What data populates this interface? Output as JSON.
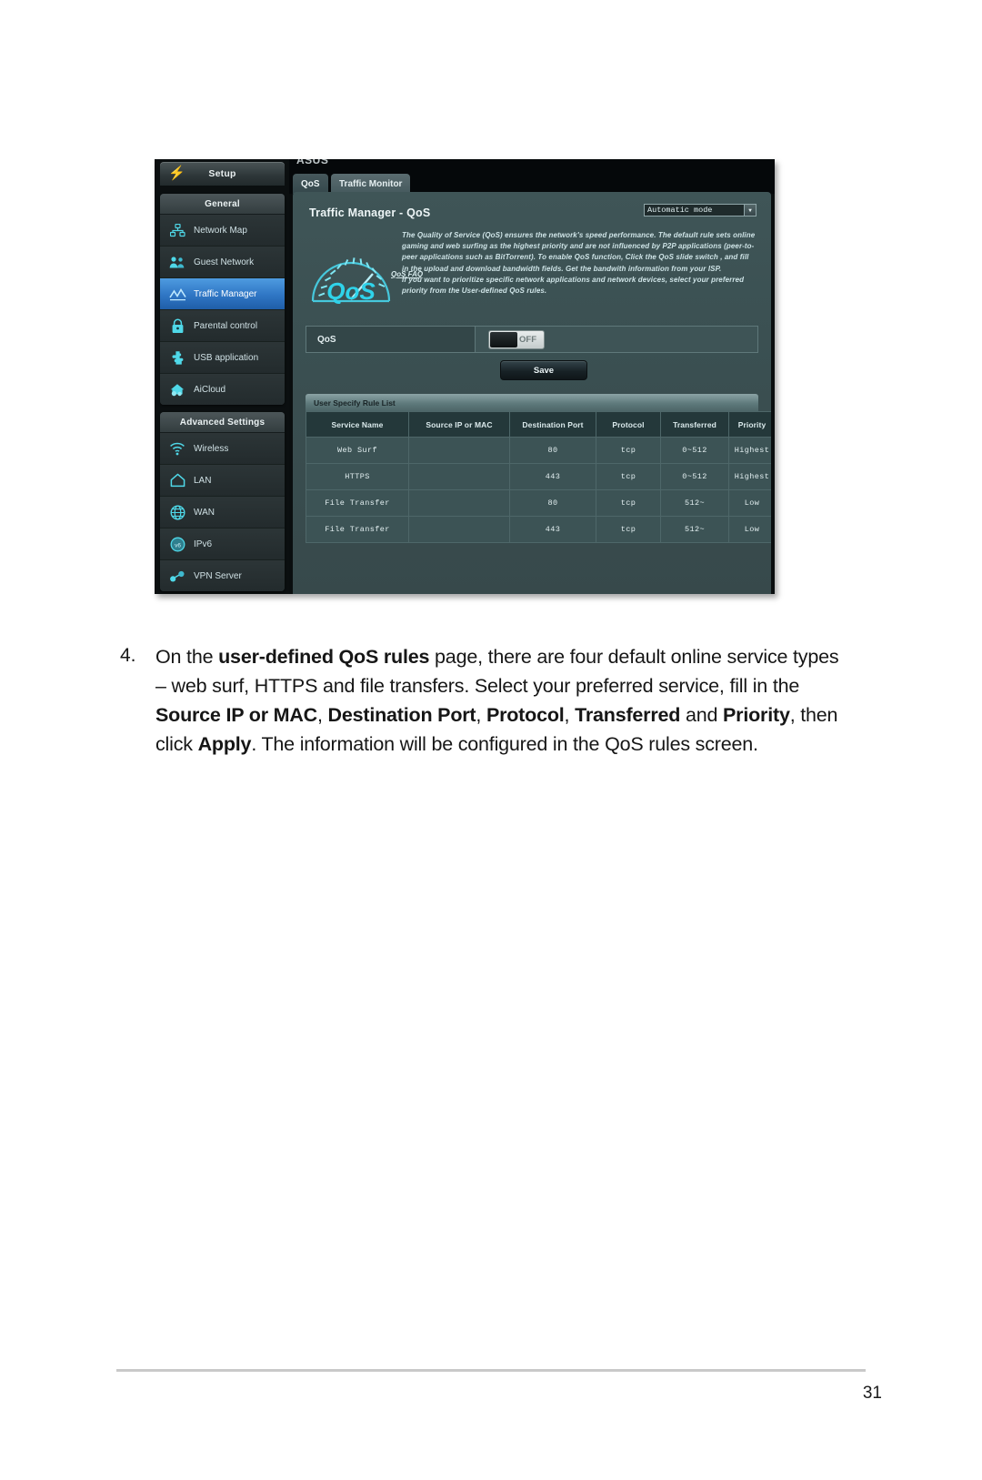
{
  "document": {
    "page_number": "31",
    "instruction": {
      "number": "4.",
      "segments": [
        {
          "text": "On the ",
          "bold": false
        },
        {
          "text": "user-defined QoS rules",
          "bold": true
        },
        {
          "text": " page, there are four default online service types – web surf, HTTPS and file transfers. Select your preferred service, fill in the ",
          "bold": false
        },
        {
          "text": "Source IP or MAC",
          "bold": true
        },
        {
          "text": ", ",
          "bold": false
        },
        {
          "text": "Destination Port",
          "bold": true
        },
        {
          "text": ", ",
          "bold": false
        },
        {
          "text": "Protocol",
          "bold": true
        },
        {
          "text": ", ",
          "bold": false
        },
        {
          "text": "Transferred",
          "bold": true
        },
        {
          "text": " and ",
          "bold": false
        },
        {
          "text": "Priority",
          "bold": true
        },
        {
          "text": ", then click ",
          "bold": false
        },
        {
          "text": "Apply",
          "bold": true
        },
        {
          "text": ". The information will be configured in the QoS rules screen.",
          "bold": false
        }
      ]
    }
  },
  "screenshot": {
    "masthead_title": "ASUS",
    "sidebar": {
      "setup_label": "Setup",
      "groups": [
        {
          "header": "General",
          "items": [
            {
              "label": "Network Map",
              "icon": "network-map-icon",
              "active": false
            },
            {
              "label": "Guest Network",
              "icon": "guest-network-icon",
              "active": false
            },
            {
              "label": "Traffic Manager",
              "icon": "traffic-manager-icon",
              "active": true
            },
            {
              "label": "Parental control",
              "icon": "lock-icon",
              "active": false
            },
            {
              "label": "USB application",
              "icon": "usb-puzzle-icon",
              "active": false
            },
            {
              "label": "AiCloud",
              "icon": "cloud-icon",
              "active": false
            }
          ]
        },
        {
          "header": "Advanced Settings",
          "items": [
            {
              "label": "Wireless",
              "icon": "wireless-icon",
              "active": false
            },
            {
              "label": "LAN",
              "icon": "home-icon",
              "active": false
            },
            {
              "label": "WAN",
              "icon": "globe-icon",
              "active": false
            },
            {
              "label": "IPv6",
              "icon": "ipv6-globe-icon",
              "active": false
            },
            {
              "label": "VPN Server",
              "icon": "vpn-icon",
              "active": false
            }
          ]
        }
      ]
    },
    "tabs": [
      {
        "label": "QoS",
        "selected": true
      },
      {
        "label": "Traffic Monitor",
        "selected": false
      }
    ],
    "panel": {
      "title": "Traffic Manager - QoS",
      "mode_select": {
        "value": "Automatic mode",
        "chevron": "chevron-down-icon"
      },
      "gauge_label": "QoS",
      "description": [
        "The Quality of Service (QoS) ensures the network's speed performance. The default rule sets online gaming and web surfing as the highest priority and are not influenced by P2P applications (peer-to-peer applications such as BitTorrent). To enable QoS function, Click the QoS slide switch , and fill in the upload and download bandwidth fields. Get the bandwith information from your ISP.",
        "If you want to prioritize specific network applications and network devices, select your preferred priority from the User-defined QoS rules."
      ],
      "faq_link": "QoS FAQ",
      "qos_switch": {
        "label": "QoS",
        "state": "OFF"
      },
      "save_label": "Save",
      "rule_list": {
        "title": "User Specify Rule List",
        "columns": [
          "Service Name",
          "Source IP or MAC",
          "Destination Port",
          "Protocol",
          "Transferred",
          "Priority"
        ],
        "rows": [
          [
            "Web Surf",
            "",
            "80",
            "tcp",
            "0~512",
            "Highest"
          ],
          [
            "HTTPS",
            "",
            "443",
            "tcp",
            "0~512",
            "Highest"
          ],
          [
            "File Transfer",
            "",
            "80",
            "tcp",
            "512~",
            "Low"
          ],
          [
            "File Transfer",
            "",
            "443",
            "tcp",
            "512~",
            "Low"
          ]
        ]
      }
    },
    "colors": {
      "accent_cyan": "#4fd8e8",
      "active_blue": "#2f76c4",
      "panel_bg": "#3a4f51",
      "nav_bg": "#232b2d",
      "table_header": "#24383a"
    }
  }
}
